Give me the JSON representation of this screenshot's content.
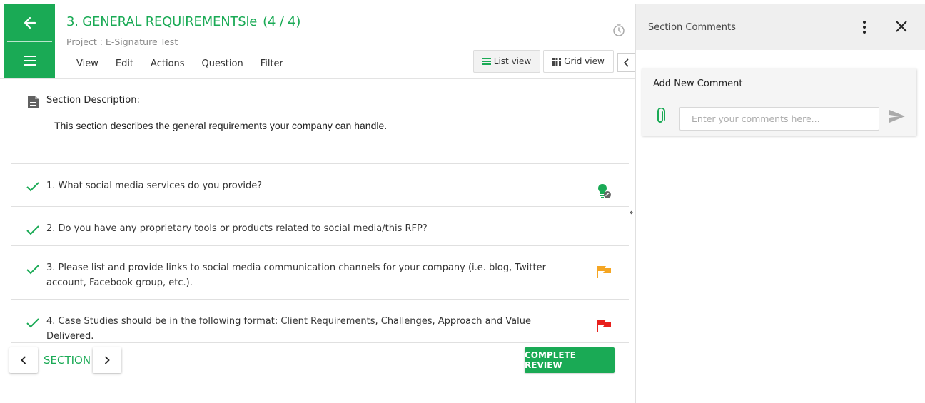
{
  "header": {
    "title": "3. GENERAL REQUIREMENTSle",
    "count": "(4 / 4)",
    "project": "Project : E-Signature Test",
    "menu": [
      "View",
      "Edit",
      "Actions",
      "Question",
      "Filter"
    ],
    "list_view_label": "List view",
    "grid_view_label": "Grid view"
  },
  "section": {
    "description_label": "Section Description:",
    "description_text": "This section describes the general requirements your company can handle."
  },
  "questions": [
    {
      "text": "1. What social media services do you provide?",
      "icon": "lightbulb-icon"
    },
    {
      "text": "2. Do you have any proprietary tools or products related to social media/this RFP?",
      "icon": ""
    },
    {
      "text": "3. Please list and provide links to social media communication channels for your company (i.e. blog, Twitter account, Facebook group, etc.).",
      "icon": "flag-orange-icon"
    },
    {
      "text": "4. Case Studies should be in the following format: Client Requirements, Challenges, Approach and Value Delivered.",
      "icon": "flag-red-icon"
    }
  ],
  "footer": {
    "section_label": "SECTION",
    "complete_label": "COMPLETE REVIEW"
  },
  "panel": {
    "title": "Section Comments",
    "card_title": "Add New Comment",
    "input_placeholder": "Enter your comments here..."
  },
  "colors": {
    "accent": "#1aaa55",
    "flag_orange": "#f5a623",
    "flag_red": "#e8201c"
  }
}
